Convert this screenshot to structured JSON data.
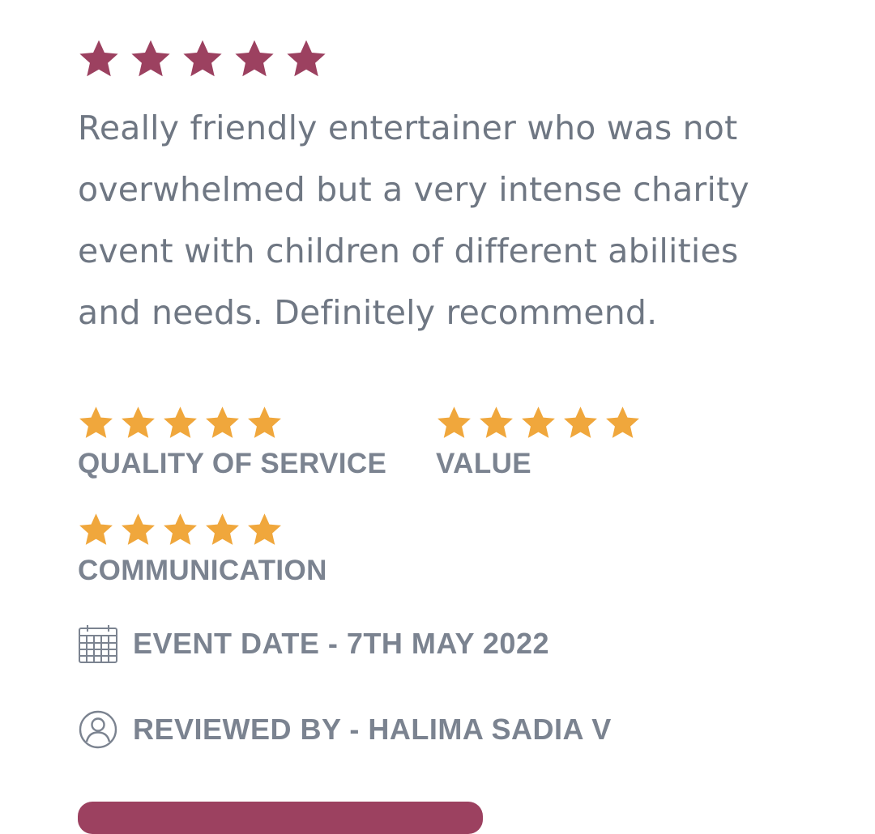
{
  "colors": {
    "overall_star": "#9c4160",
    "rating_star": "#f0a73c",
    "text": "#6f7783",
    "label": "#7b8390",
    "button": "#9c4160"
  },
  "review": {
    "overall_rating": 5,
    "overall_max": 5,
    "text": "Really friendly entertainer who was not overwhelmed but a very intense charity event with children of different abilities and needs. Definitely recommend."
  },
  "ratings": [
    {
      "label": "QUALITY OF SERVICE",
      "value": 5,
      "max": 5
    },
    {
      "label": "VALUE",
      "value": 5,
      "max": 5
    },
    {
      "label": "COMMUNICATION",
      "value": 5,
      "max": 5
    }
  ],
  "meta": {
    "event_date_icon": "calendar-icon",
    "event_date": "EVENT DATE - 7TH MAY 2022",
    "reviewer_icon": "user-circle-icon",
    "reviewed_by": "REVIEWED BY - HALIMA SADIA V"
  }
}
